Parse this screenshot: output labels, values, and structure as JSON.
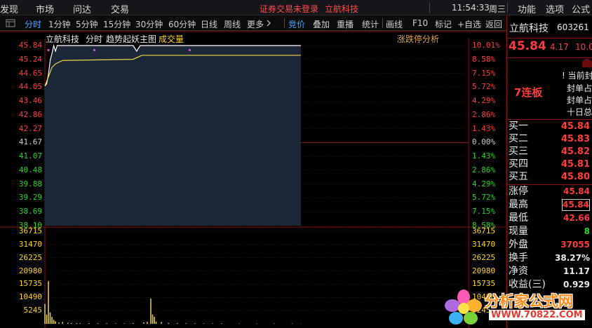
{
  "menubar": {
    "items": [
      "发现",
      "市场",
      "问达",
      "交易"
    ],
    "status_text": "证券交易未登录",
    "stock_name": "立航科技",
    "clock": "11:54:33",
    "weekday": "周三",
    "right_items": [
      "功能",
      "选项",
      "公式"
    ]
  },
  "toolbar": {
    "back_icon": "list-icon",
    "tabs": [
      "分时",
      "1分钟",
      "5分钟",
      "15分钟",
      "30分钟",
      "60分钟",
      "日线",
      "周线",
      "更多"
    ],
    "more_icon": "chevron-right-icon",
    "active_tab": "分时",
    "tools": [
      "竞价",
      "叠加",
      "重播",
      "统计",
      "画线",
      "F10",
      "标记",
      "+自选",
      "返回"
    ]
  },
  "chart": {
    "stock_name": "立航科技",
    "mode": "分时",
    "indicator": "趋势起妖主图",
    "volume_label": "成交量",
    "analysis_button": "涨跌停分析",
    "colors": {
      "up": "#ff3b3b",
      "down": "#26d426",
      "flat": "#cccccc",
      "price_line": "#ffffff",
      "avg_line": "#e8d84a",
      "volume": "#e0c84a",
      "fill": "#1e2a3a"
    }
  },
  "quote": {
    "name": "立航科技",
    "code": "603261",
    "price": "45.84",
    "change": "4.17",
    "change_pct": "10.0",
    "streak": "7连板",
    "notes": [
      "当前封",
      "封单占",
      "封单占",
      "十日总"
    ],
    "bids": [
      {
        "label": "买一",
        "price": "45.84"
      },
      {
        "label": "买二",
        "price": "45.83"
      },
      {
        "label": "买三",
        "price": "45.82"
      },
      {
        "label": "买四",
        "price": "45.81"
      },
      {
        "label": "买五",
        "price": "45.80"
      }
    ],
    "stats": [
      {
        "label": "涨停",
        "value": "45.84",
        "color": "red"
      },
      {
        "label": "最高",
        "value": "45.84",
        "color": "red",
        "boxed": true
      },
      {
        "label": "最低",
        "value": "42.66",
        "color": "red"
      },
      {
        "label": "现量",
        "value": "8",
        "color": "green"
      },
      {
        "label": "外盘",
        "value": "37055",
        "color": "red"
      },
      {
        "label": "换手",
        "value": "38.27%",
        "color": "white"
      },
      {
        "label": "净资",
        "value": "11.17",
        "color": "white"
      },
      {
        "label": "收益(三)",
        "value": "0.929",
        "color": "white"
      }
    ]
  },
  "watermark": {
    "site_name": "分析家公式网",
    "url": "WWW.70822.COM"
  },
  "chart_data": {
    "type": "line",
    "title": "立航科技 分时 趋势起妖主图",
    "xlabel": "",
    "ylabel": "",
    "y_ticks": [
      "45.84",
      "45.24",
      "44.65",
      "44.05",
      "43.46",
      "42.86",
      "42.27",
      "41.67",
      "41.07",
      "40.48",
      "39.88",
      "39.29",
      "38.69",
      "38.10"
    ],
    "pct_ticks": [
      "10.01%",
      "8.58%",
      "7.15%",
      "5.72%",
      "4.29%",
      "2.86%",
      "1.43%",
      "0.00%",
      "1.43%",
      "2.86%",
      "4.29%",
      "5.72%",
      "7.15%",
      "8.58%"
    ],
    "ylim": [
      38.1,
      45.84
    ],
    "prev_close": 41.67,
    "session_minutes": 240,
    "elapsed_minutes": 145,
    "series": [
      {
        "values": [
          [
            0,
            44.1
          ],
          [
            1,
            44.2
          ],
          [
            2,
            44.6
          ],
          [
            3,
            45.2
          ],
          [
            4,
            45.5
          ],
          [
            5,
            45.84
          ],
          [
            6,
            45.6
          ],
          [
            7,
            45.84
          ],
          [
            8,
            45.84
          ],
          [
            50,
            45.84
          ],
          [
            52,
            45.6
          ],
          [
            54,
            45.84
          ],
          [
            145,
            45.84
          ]
        ]
      },
      {
        "values": [
          [
            0,
            44.1
          ],
          [
            2,
            44.5
          ],
          [
            4,
            44.9
          ],
          [
            6,
            45.05
          ],
          [
            10,
            45.2
          ],
          [
            50,
            45.25
          ],
          [
            55,
            45.42
          ],
          [
            145,
            45.42
          ]
        ]
      }
    ],
    "markers": [
      [
        2,
        45.84
      ],
      [
        28,
        45.84
      ],
      [
        82,
        45.84
      ]
    ],
    "volume": {
      "ylim": [
        0,
        41960
      ],
      "y_ticks": [
        "36715",
        "31470",
        "26225",
        "20980",
        "15735",
        "10490",
        "5245"
      ],
      "bars": [
        [
          0,
          9000
        ],
        [
          1,
          4200
        ],
        [
          2,
          19300
        ],
        [
          3,
          5200
        ],
        [
          4,
          3100
        ],
        [
          5,
          1800
        ],
        [
          6,
          1100
        ],
        [
          8,
          600
        ],
        [
          10,
          800
        ],
        [
          13,
          500
        ],
        [
          15,
          400
        ],
        [
          18,
          300
        ],
        [
          20,
          300
        ],
        [
          25,
          300
        ],
        [
          30,
          250
        ],
        [
          35,
          250
        ],
        [
          40,
          200
        ],
        [
          45,
          200
        ],
        [
          50,
          300
        ],
        [
          56,
          600
        ],
        [
          58,
          900
        ],
        [
          60,
          11400
        ],
        [
          61,
          4200
        ],
        [
          62,
          3200
        ],
        [
          63,
          1000
        ],
        [
          66,
          800
        ],
        [
          70,
          400
        ],
        [
          75,
          300
        ],
        [
          80,
          250
        ],
        [
          85,
          200
        ],
        [
          90,
          200
        ],
        [
          95,
          200
        ],
        [
          100,
          200
        ],
        [
          110,
          150
        ],
        [
          120,
          150
        ],
        [
          130,
          150
        ],
        [
          140,
          150
        ],
        [
          145,
          100
        ]
      ]
    }
  }
}
